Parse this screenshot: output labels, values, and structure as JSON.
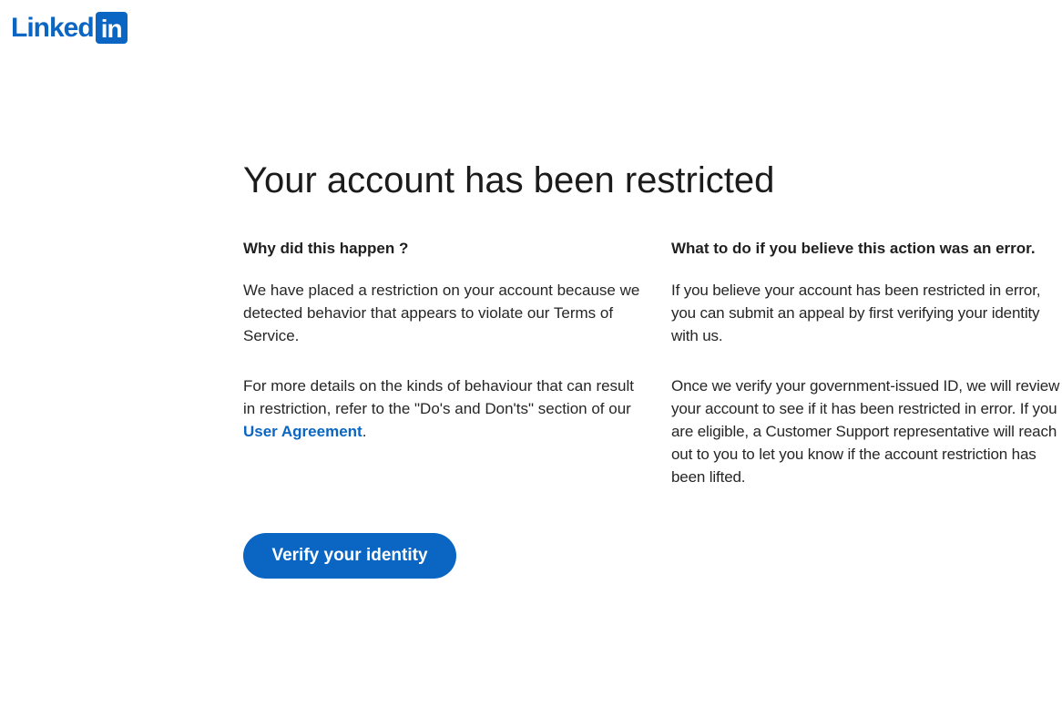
{
  "brand": {
    "logo_word": "Linked",
    "logo_box": "in",
    "color": "#0a66c2"
  },
  "page": {
    "headline": "Your account has been restricted"
  },
  "left_column": {
    "heading": "Why did this happen ?",
    "paragraph1": "We have placed a restriction on your account because we detected behavior that appears to violate our Terms of Service.",
    "paragraph2_before": "For more details on the kinds of behaviour that can result in restriction, refer to the \"Do's and Don'ts\" section of our ",
    "paragraph2_link": "User Agreement",
    "paragraph2_after": "."
  },
  "right_column": {
    "heading": "What to do if you believe this action was an error.",
    "paragraph1": "If you believe your account has been restricted in error, you can submit an appeal by first verifying your identity with us.",
    "paragraph2": "Once we verify your government-issued ID, we will review your account to see if it has been restricted in error. If you are eligible, a Customer Support representative will reach out to you to let you know if the account restriction has been lifted."
  },
  "actions": {
    "verify_label": "Verify your identity"
  }
}
